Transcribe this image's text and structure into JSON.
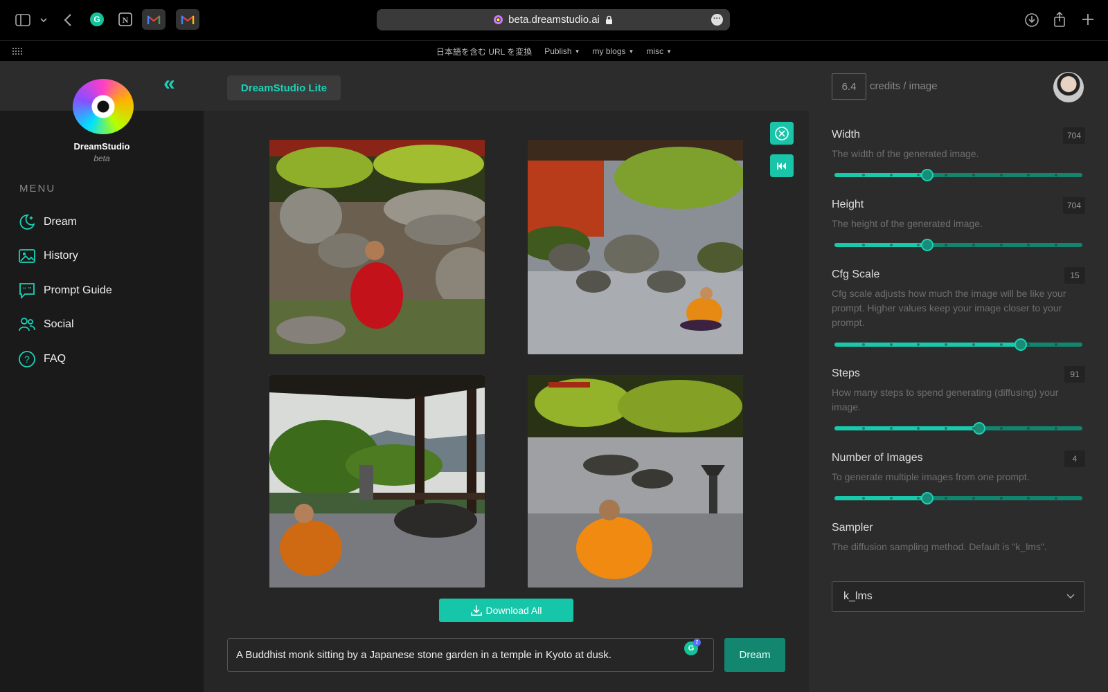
{
  "browser": {
    "url": "beta.dreamstudio.ai",
    "bookmarks": [
      {
        "label": "日本語を含む URL を変換"
      },
      {
        "label": "Publish"
      },
      {
        "label": "my blogs"
      },
      {
        "label": "misc"
      }
    ]
  },
  "brand": {
    "name": "DreamStudio",
    "beta": "beta"
  },
  "sidebar": {
    "menu_title": "MENU",
    "items": [
      {
        "label": "Dream",
        "icon": "moon-stars-icon"
      },
      {
        "label": "History",
        "icon": "images-icon"
      },
      {
        "label": "Prompt Guide",
        "icon": "quote-bubble-icon"
      },
      {
        "label": "Social",
        "icon": "people-icon"
      },
      {
        "label": "FAQ",
        "icon": "question-circle-icon"
      }
    ]
  },
  "header": {
    "lite_label": "DreamStudio Lite",
    "credits": "6.4",
    "credits_label": "credits / image"
  },
  "gallery": {
    "images": [
      {
        "alt": "Monk in red robe sitting among stones in a garden"
      },
      {
        "alt": "Monk in orange robe meditating in a raked gravel garden"
      },
      {
        "alt": "Monk sitting on a temple veranda facing a pine garden"
      },
      {
        "alt": "Monk in orange robe seated in a stone garden with lanterns"
      }
    ],
    "download_label": "Download All"
  },
  "prompt": {
    "text": "A Buddhist monk sitting by a Japanese stone garden in a temple in Kyoto at dusk.",
    "dream_label": "Dream",
    "grammarly_count": "2"
  },
  "settings": {
    "width": {
      "title": "Width",
      "value": "704",
      "desc": "The width of the generated image.",
      "level": 0.375
    },
    "height": {
      "title": "Height",
      "value": "704",
      "desc": "The height of the generated image.",
      "level": 0.375
    },
    "cfg": {
      "title": "Cfg Scale",
      "value": "15",
      "desc": "Cfg scale adjusts how much the image will be like your prompt. Higher values keep your image closer to your prompt.",
      "level": 0.75
    },
    "steps": {
      "title": "Steps",
      "value": "91",
      "desc": "How many steps to spend generating (diffusing) your image.",
      "level": 0.585
    },
    "num_images": {
      "title": "Number of Images",
      "value": "4",
      "desc": "To generate multiple images from one prompt.",
      "level": 0.375
    },
    "sampler": {
      "title": "Sampler",
      "desc": "The diffusion sampling method. Default is \"k_lms\".",
      "value": "k_lms"
    }
  },
  "colors": {
    "accent": "#19d3b7",
    "button": "#15c6a9",
    "dark_button": "#13866f"
  }
}
